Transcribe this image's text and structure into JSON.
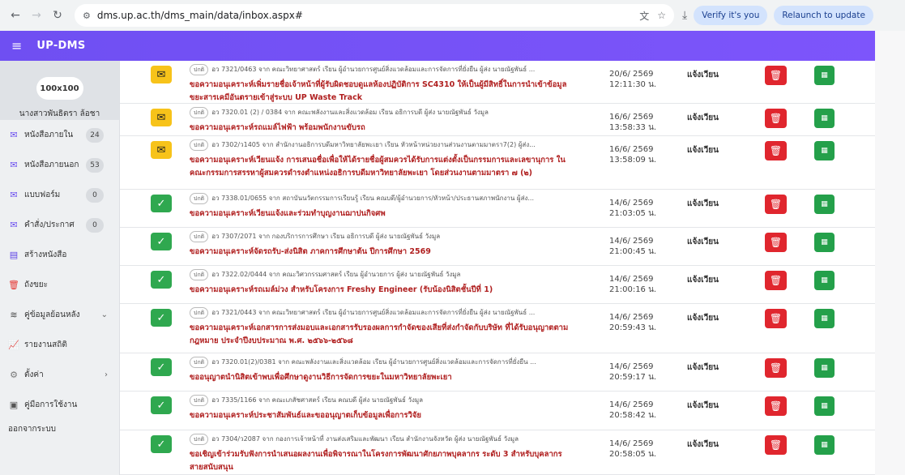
{
  "browser": {
    "url": "dms.up.ac.th/dms_main/data/inbox.aspx#",
    "verify_label": "Verify it's you",
    "relaunch_label": "Relaunch to update"
  },
  "app": {
    "title": "UP-DMS"
  },
  "sidebar": {
    "avatar_text": "100x100",
    "user_name": "นางสาวพันธิตรา ล้อชา",
    "items": [
      {
        "label": "หนังสือภายใน",
        "badge": "24",
        "icon": "inbox-icon"
      },
      {
        "label": "หนังสือภายนอก",
        "badge": "53",
        "icon": "inbox-icon"
      },
      {
        "label": "แบบฟอร์ม",
        "badge": "0",
        "icon": "inbox-icon"
      },
      {
        "label": "คำสั่ง/ประกาศ",
        "badge": "0",
        "icon": "inbox-icon"
      },
      {
        "label": "สร้างหนังสือ",
        "icon": "document-icon"
      },
      {
        "label": "ถังขยะ",
        "icon": "trash-icon"
      },
      {
        "label": "คู่ข้อมูลย้อนหลัง",
        "icon": "layers-icon"
      },
      {
        "label": "รายงานสถิติ",
        "icon": "chart-icon"
      },
      {
        "label": "ตั้งค่า",
        "icon": "gear-icon"
      },
      {
        "label": "คู่มือการใช้งาน",
        "icon": "book-icon"
      },
      {
        "label": "ออกจากระบบ"
      }
    ]
  },
  "rows": [
    {
      "status": "envelope",
      "tag": "ปกติ",
      "meta": "อว 7321/0463 จาก คณะวิทยาศาสตร์ เรียน ผู้อำนวยการศูนย์สิ่งแวดล้อมและการจัดการที่ยั่งยืน ผู้ส่ง นายณัฐพันธ์ ...",
      "subject": "ขอความอนุเคราะห์เพิ่มรายชื่อเจ้าหน้าที่ผู้รับผิดชอบดูแลห้องปฏิบัติการ SC4310 ให้เป็นผู้มีสิทธิ์ในการนำเข้าข้อมูลขยะสารเคมีอันตรายเข้าสู่ระบบ UP Waste Track",
      "date": "20/6/ 2569",
      "time": "12:11:30 น.",
      "action": "แจ้งเวียน"
    },
    {
      "status": "envelope",
      "tag": "ปกติ",
      "meta": "อว 7320.01 (2) / 0384 จาก คณะพลังงานและสิ่งแวดล้อม เรียน อธิการบดี ผู้ส่ง นายณัฐพันธ์ วังมูล",
      "subject": "ขอความอนุเคราะห์รถแมล์ไฟฟ้า พร้อมพนักงานขับรถ",
      "date": "16/6/ 2569",
      "time": "13:58:33 น.",
      "action": "แจ้งเวียน"
    },
    {
      "status": "envelope",
      "tag": "ปกติ",
      "meta": "อว 7302/ว1405 จาก สำนักงานอธิการบดีมหาวิทยาลัยพะเยา เรียน หัวหน้าหน่วยงานส่วนงานตามมาตรา7(2) ผู้ส่ง...",
      "subject": "ขอความอนุเคราะห์เวียนแจ้ง การเสนอชื่อเพื่อให้ได้รายชื่อผู้สมควรได้รับการแต่งตั้งเป็นกรรมการและเลขานุการ ในคณะกรรมการสรรหาผู้สมควรดำรงตำแหน่งอธิการบดีมหาวิทยาลัยพะเยา โดยส่วนงานตามมาตรา ๗ (๒)",
      "date": "16/6/ 2569",
      "time": "13:58:09 น.",
      "action": "แจ้งเวียน"
    },
    {
      "status": "check",
      "tag": "ปกติ",
      "meta": "อว 7338.01/0655 จาก สถาบันนวัตกรรมการเรียนรู้ เรียน คณบดี/ผู้อำนวยการ/หัวหน้า/ประธานสภาพนักงาน ผู้ส่ง...",
      "subject": "ขอความอนุเคราะห์เวียนแจ้งและร่วมทำบุญงานฌาปนกิจศพ",
      "date": "14/6/ 2569",
      "time": "21:03:05 น.",
      "action": "แจ้งเวียน"
    },
    {
      "status": "check",
      "tag": "ปกติ",
      "meta": "อว 7307/2071 จาก กองบริการการศึกษา เรียน อธิการบดี ผู้ส่ง นายณัฐพันธ์ วังมูล",
      "subject": "ขอความอนุเคราะห์จัดรถรับ-ส่งนิสิต ภาคการศึกษาต้น ปีการศึกษา 2569",
      "date": "14/6/ 2569",
      "time": "21:00:45 น.",
      "action": "แจ้งเวียน"
    },
    {
      "status": "check",
      "tag": "ปกติ",
      "meta": "อว 7322.02/0444 จาก คณะวิศวกรรมศาสตร์ เรียน ผู้อำนวยการ ผู้ส่ง นายณัฐพันธ์ วังมูล",
      "subject": "ขอความอนุเคราะห์รถเมล์ม่วง สำหรับโครงการ Freshy Engineer (รับน้องนิสิตชั้นปีที่ 1)",
      "date": "14/6/ 2569",
      "time": "21:00:16 น.",
      "action": "แจ้งเวียน"
    },
    {
      "status": "check",
      "tag": "ปกติ",
      "meta": "อว 7321/0443 จาก คณะวิทยาศาสตร์ เรียน ผู้อำนวยการศูนย์สิ่งแวดล้อมและการจัดการที่ยั่งยืน ผู้ส่ง นายณัฐพันธ์ ...",
      "subject": "ขอความอนุเคราะห์เอกสารการส่งมอบและเอกสารรับรองผลการกำจัดของเสียที่ส่งกำจัดกับบริษัท ที่ได้รับอนุญาตตามกฎหมาย ประจำปีงบประมาณ พ.ศ. ๒๕๖๖-๒๕๖๘",
      "date": "14/6/ 2569",
      "time": "20:59:43 น.",
      "action": "แจ้งเวียน"
    },
    {
      "status": "check",
      "tag": "ปกติ",
      "meta": "อว 7320.01(2)/0381 จาก คณะพลังงานและสิ่งแวดล้อม เรียน ผู้อำนวยการศูนย์สิ่งแวดล้อมและการจัดการที่ยั่งยืน ...",
      "subject": "ขออนุญาตนำนิสิตเข้าพบเพื่อศึกษาดูงานวิธีการจัดการขยะในมหาวิทยาลัยพะเยา",
      "date": "14/6/ 2569",
      "time": "20:59:17 น.",
      "action": "แจ้งเวียน"
    },
    {
      "status": "check",
      "tag": "ปกติ",
      "meta": "อว 7335/1166 จาก คณะเภสัชศาสตร์ เรียน คณบดี ผู้ส่ง นายณัฐพันธ์ วังมูล",
      "subject": "ขอความอนุเคราะห์ประชาสัมพันธ์และขออนุญาตเก็บข้อมูลเพื่อการวิจัย",
      "date": "14/6/ 2569",
      "time": "20:58:42 น.",
      "action": "แจ้งเวียน"
    },
    {
      "status": "check",
      "tag": "ปกติ",
      "meta": "อว 7304/ว2087 จาก กองการเจ้าหน้าที่ งานส่งเสริมและพัฒนา เรียน สำนักงานจังหวัด ผู้ส่ง นายณัฐพันธ์ วังมูล",
      "subject": "ขอเชิญเข้าร่วมรับฟังการนำเสนอผลงานเพื่อพิจารณาในโครงการพัฒนาศักยภาพบุคลากร ระดับ 3 สำหรับบุคลากรสายสนับสนุน",
      "date": "14/6/ 2569",
      "time": "20:58:05 น.",
      "action": "แจ้งเวียน"
    }
  ]
}
